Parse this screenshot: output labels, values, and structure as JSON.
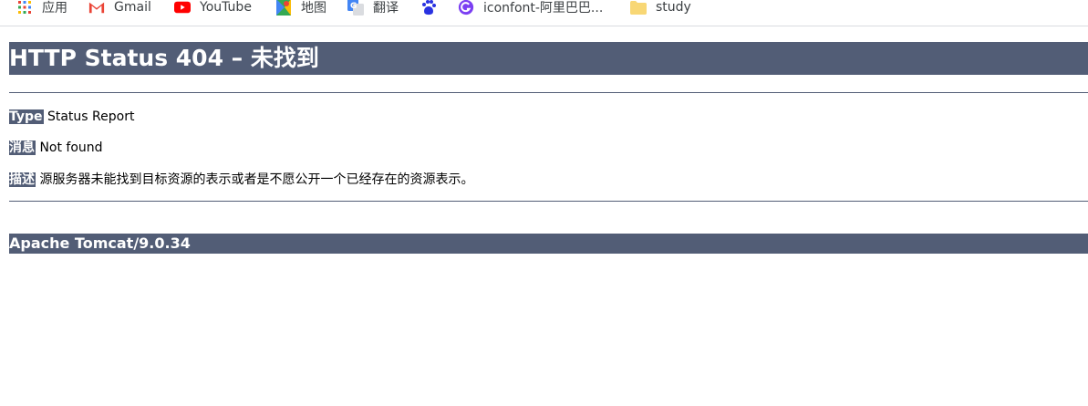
{
  "bookmarks": {
    "items": [
      {
        "label": "应用",
        "icon": "apps-grid-icon"
      },
      {
        "label": "Gmail",
        "icon": "gmail-icon"
      },
      {
        "label": "YouTube",
        "icon": "youtube-icon"
      },
      {
        "label": "地图",
        "icon": "maps-icon"
      },
      {
        "label": "翻译",
        "icon": "translate-icon"
      },
      {
        "label": "",
        "icon": "baidu-icon"
      },
      {
        "label": "iconfont-阿里巴巴...",
        "icon": "iconfont-icon"
      },
      {
        "label": "study",
        "icon": "folder-icon"
      }
    ]
  },
  "page": {
    "title": "HTTP Status 404 – 未找到",
    "type_label": "Type",
    "type_value": " Status Report",
    "message_label": "消息",
    "message_value": " Not found",
    "description_label": "描述",
    "description_value": " 源服务器未能找到目标资源的表示或者是不愿公开一个已经存在的资源表示。",
    "footer": "Apache Tomcat/9.0.34"
  },
  "colors": {
    "header_bg": "#525d76",
    "header_text": "#ffffff"
  }
}
